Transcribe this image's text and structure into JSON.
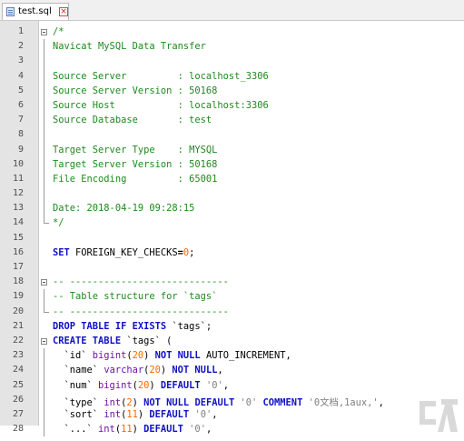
{
  "tab": {
    "label": "test.sql"
  },
  "lines": [
    {
      "n": "1",
      "segs": [
        {
          "t": "/*",
          "c": "cmt"
        }
      ]
    },
    {
      "n": "2",
      "segs": [
        {
          "t": "Navicat MySQL Data Transfer",
          "c": "cmt"
        }
      ]
    },
    {
      "n": "3",
      "segs": []
    },
    {
      "n": "4",
      "segs": [
        {
          "t": "Source Server         : localhost_3306",
          "c": "cmt"
        }
      ]
    },
    {
      "n": "5",
      "segs": [
        {
          "t": "Source Server Version : 50168",
          "c": "cmt"
        }
      ]
    },
    {
      "n": "6",
      "segs": [
        {
          "t": "Source Host           : localhost:3306",
          "c": "cmt"
        }
      ]
    },
    {
      "n": "7",
      "segs": [
        {
          "t": "Source Database       : test",
          "c": "cmt"
        }
      ]
    },
    {
      "n": "8",
      "segs": []
    },
    {
      "n": "9",
      "segs": [
        {
          "t": "Target Server Type    : MYSQL",
          "c": "cmt"
        }
      ]
    },
    {
      "n": "10",
      "segs": [
        {
          "t": "Target Server Version : 50168",
          "c": "cmt"
        }
      ]
    },
    {
      "n": "11",
      "segs": [
        {
          "t": "File Encoding         : 65001",
          "c": "cmt"
        }
      ]
    },
    {
      "n": "12",
      "segs": []
    },
    {
      "n": "13",
      "segs": [
        {
          "t": "Date: 2018-04-19 09:28:15",
          "c": "cmt"
        }
      ]
    },
    {
      "n": "14",
      "segs": [
        {
          "t": "*/",
          "c": "cmt"
        }
      ]
    },
    {
      "n": "15",
      "segs": []
    },
    {
      "n": "16",
      "segs": [
        {
          "t": "SET",
          "c": "kw"
        },
        {
          "t": " FOREIGN_KEY_CHECKS",
          "c": ""
        },
        {
          "t": "=",
          "c": "op"
        },
        {
          "t": "0",
          "c": "num"
        },
        {
          "t": ";",
          "c": ""
        }
      ]
    },
    {
      "n": "17",
      "segs": []
    },
    {
      "n": "18",
      "segs": [
        {
          "t": "-- ----------------------------",
          "c": "cmt"
        }
      ]
    },
    {
      "n": "19",
      "segs": [
        {
          "t": "-- Table structure for `tags`",
          "c": "cmt"
        }
      ]
    },
    {
      "n": "20",
      "segs": [
        {
          "t": "-- ----------------------------",
          "c": "cmt"
        }
      ]
    },
    {
      "n": "21",
      "segs": [
        {
          "t": "DROP TABLE IF EXISTS",
          "c": "kw"
        },
        {
          "t": " `tags`;",
          "c": ""
        }
      ]
    },
    {
      "n": "22",
      "segs": [
        {
          "t": "CREATE TABLE",
          "c": "kw"
        },
        {
          "t": " `tags` (",
          "c": ""
        }
      ]
    },
    {
      "n": "23",
      "segs": [
        {
          "t": "  `id` ",
          "c": ""
        },
        {
          "t": "bigint",
          "c": "ty"
        },
        {
          "t": "(",
          "c": ""
        },
        {
          "t": "20",
          "c": "num"
        },
        {
          "t": ") ",
          "c": ""
        },
        {
          "t": "NOT NULL",
          "c": "kw"
        },
        {
          "t": " AUTO_INCREMENT,",
          "c": ""
        }
      ]
    },
    {
      "n": "24",
      "segs": [
        {
          "t": "  `name` ",
          "c": ""
        },
        {
          "t": "varchar",
          "c": "ty"
        },
        {
          "t": "(",
          "c": ""
        },
        {
          "t": "20",
          "c": "num"
        },
        {
          "t": ") ",
          "c": ""
        },
        {
          "t": "NOT NULL",
          "c": "kw"
        },
        {
          "t": ",",
          "c": ""
        }
      ]
    },
    {
      "n": "25",
      "segs": [
        {
          "t": "  `num` ",
          "c": ""
        },
        {
          "t": "bigint",
          "c": "ty"
        },
        {
          "t": "(",
          "c": ""
        },
        {
          "t": "20",
          "c": "num"
        },
        {
          "t": ") ",
          "c": ""
        },
        {
          "t": "DEFAULT",
          "c": "kw"
        },
        {
          "t": " '0'",
          "c": "str"
        },
        {
          "t": ",",
          "c": ""
        }
      ]
    },
    {
      "n": "26",
      "segs": [
        {
          "t": "  `type` ",
          "c": ""
        },
        {
          "t": "int",
          "c": "ty"
        },
        {
          "t": "(",
          "c": ""
        },
        {
          "t": "2",
          "c": "num"
        },
        {
          "t": ") ",
          "c": ""
        },
        {
          "t": "NOT NULL DEFAULT",
          "c": "kw"
        },
        {
          "t": " '0'",
          "c": "str"
        },
        {
          "t": " ",
          "c": ""
        },
        {
          "t": "COMMENT",
          "c": "kw"
        },
        {
          "t": " '0文档,1aux,'",
          "c": "str"
        },
        {
          "t": ",",
          "c": ""
        }
      ]
    },
    {
      "n": "27",
      "segs": [
        {
          "t": "  `sort` ",
          "c": ""
        },
        {
          "t": "int",
          "c": "ty"
        },
        {
          "t": "(",
          "c": ""
        },
        {
          "t": "11",
          "c": "num"
        },
        {
          "t": ") ",
          "c": ""
        },
        {
          "t": "DEFAULT",
          "c": "kw"
        },
        {
          "t": " '0'",
          "c": "str"
        },
        {
          "t": ",",
          "c": ""
        }
      ]
    },
    {
      "n": "28",
      "segs": [
        {
          "t": "  `...` ",
          "c": ""
        },
        {
          "t": "int",
          "c": "ty"
        },
        {
          "t": "(",
          "c": ""
        },
        {
          "t": "11",
          "c": "num"
        },
        {
          "t": ") ",
          "c": ""
        },
        {
          "t": "DEFAULT",
          "c": "kw"
        },
        {
          "t": " '0'",
          "c": "str"
        },
        {
          "t": ",",
          "c": ""
        }
      ]
    }
  ],
  "colors": {
    "comment": "#1d8a1d",
    "keyword": "#1010c8",
    "type": "#6b14a5",
    "number": "#ff6600",
    "string": "#7f7f7f"
  }
}
